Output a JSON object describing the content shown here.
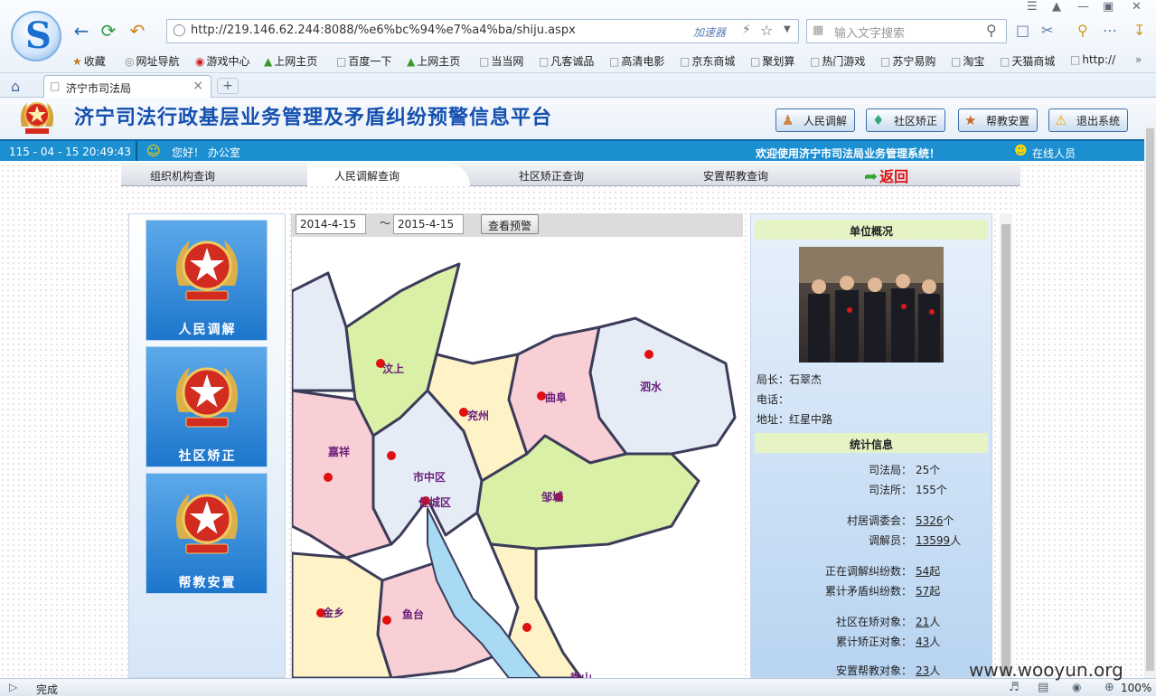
{
  "browser": {
    "url": "http://219.146.62.244:8088/%e6%bc%94%e7%a4%ba/shiju.aspx",
    "accelerator": "加速器",
    "search_placeholder": "输入文字搜索",
    "favorites": [
      "收藏",
      "网址导航",
      "游戏中心",
      "上网主页",
      "百度一下",
      "上网主页",
      "当当网",
      "凡客诚品",
      "高清电影",
      "京东商城",
      "聚划算",
      "热门游戏",
      "苏宁易购",
      "淘宝",
      "天猫商城",
      "http://"
    ],
    "tab_title": "济宁市司法局",
    "status": "完成",
    "zoom": "100%"
  },
  "site": {
    "title": "济宁司法行政基层业务管理及矛盾纠纷预警信息平台",
    "header_buttons": [
      "人民调解",
      "社区矫正",
      "帮教安置",
      "退出系统"
    ]
  },
  "infobar": {
    "datetime": "115 - 04 - 15  20:49:43",
    "greeting": "您好！  办公室",
    "welcome": "欢迎使用济宁市司法局业务管理系统！",
    "online": "在线人员"
  },
  "nav": {
    "tabs": [
      "组织机构查询",
      "人民调解查询",
      "社区矫正查询",
      "安置帮教查询"
    ],
    "back": "返回"
  },
  "left": {
    "buttons": [
      "人民调解",
      "社区矫正",
      "帮教安置"
    ]
  },
  "filter": {
    "start": "2014-4-15",
    "tilde": "〜",
    "end": "2015-4-15",
    "query": "查看预警"
  },
  "map": {
    "regions": [
      "汶上",
      "兖州",
      "曲阜",
      "泗水",
      "嘉祥",
      "市中区",
      "任城区",
      "邹城",
      "金乡",
      "鱼台",
      "微山"
    ]
  },
  "unit": {
    "header": "单位概况",
    "director_label": "局长：",
    "director": "石翠杰",
    "phone_label": "电话：",
    "address_label": "地址：",
    "address": "红星中路"
  },
  "stats": {
    "header": "统计信息",
    "rows": [
      {
        "label": "司法局：",
        "value": "25",
        "unit": "个"
      },
      {
        "label": "司法所：",
        "value": "155",
        "unit": "个"
      },
      {
        "label": "村居调委会：",
        "value": "5326",
        "unit": "个"
      },
      {
        "label": "调解员：",
        "value": "13599",
        "unit": "人"
      },
      {
        "label": "正在调解纠纷数：",
        "value": "54",
        "unit": "起"
      },
      {
        "label": "累计矛盾纠纷数：",
        "value": "57",
        "unit": "起"
      },
      {
        "label": "社区在矫对象：",
        "value": "21",
        "unit": "人"
      },
      {
        "label": "累计矫正对象：",
        "value": "43",
        "unit": "人"
      },
      {
        "label": "安置帮教对象：",
        "value": "23",
        "unit": "人"
      }
    ]
  },
  "watermark": "www.wooyun.org"
}
